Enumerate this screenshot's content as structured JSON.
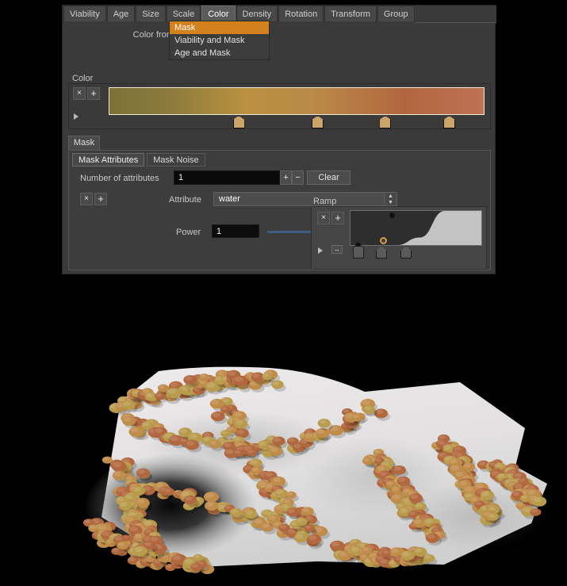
{
  "panel": {
    "tabs": [
      {
        "label": "Viability",
        "active": false
      },
      {
        "label": "Age",
        "active": false
      },
      {
        "label": "Size",
        "active": false
      },
      {
        "label": "Scale",
        "active": false
      },
      {
        "label": "Color",
        "active": true
      },
      {
        "label": "Density",
        "active": false
      },
      {
        "label": "Rotation",
        "active": false
      },
      {
        "label": "Transform",
        "active": false
      },
      {
        "label": "Group",
        "active": false
      }
    ],
    "color_from": {
      "label": "Color from",
      "value": "Mask",
      "open": true,
      "options": [
        "Mask",
        "Viability and Mask",
        "Age and Mask"
      ],
      "selected_index": 0
    },
    "color_section": {
      "label": "Color",
      "remove_label": "×",
      "add_label": "+",
      "gradient_stops": [
        {
          "position": 0.0,
          "color": "#7d7236"
        },
        {
          "position": 0.155,
          "color": "#8a7a3c"
        },
        {
          "position": 0.36,
          "color": "#b9913f"
        },
        {
          "position": 0.545,
          "color": "#b98a48"
        },
        {
          "position": 0.79,
          "color": "#b2663f"
        },
        {
          "position": 1.0,
          "color": "#bf7254"
        }
      ],
      "stop_markers": [
        0.345,
        0.555,
        0.735,
        0.905
      ]
    },
    "mask_group": {
      "tab_label": "Mask",
      "subtabs": [
        {
          "label": "Mask Attributes",
          "active": true
        },
        {
          "label": "Mask Noise",
          "active": false
        }
      ],
      "number_of_attributes": {
        "label": "Number of attributes",
        "value": "1",
        "increment": "+",
        "decrement": "−"
      },
      "clear_label": "Clear",
      "attribute_row": {
        "remove_label": "×",
        "add_label": "+",
        "label": "Attribute",
        "value": "water"
      },
      "power": {
        "label": "Power",
        "value": "1",
        "slider_position": 1.0
      },
      "ramp": {
        "label": "Ramp",
        "remove_label": "×",
        "add_label": "+",
        "fit_label": "↔",
        "curve_points": [
          {
            "x": 0.0,
            "y": 0.0
          },
          {
            "x": 0.355,
            "y": 0.0
          },
          {
            "x": 0.53,
            "y": 0.22
          },
          {
            "x": 0.72,
            "y": 1.0
          },
          {
            "x": 1.0,
            "y": 1.0
          }
        ],
        "handles": [
          {
            "position": 0.355,
            "type": "square",
            "selected": false
          },
          {
            "position": 0.53,
            "type": "house",
            "selected": true
          },
          {
            "position": 0.72,
            "type": "house",
            "selected": false
          }
        ]
      }
    }
  },
  "viewport": {
    "name": "3d-render-viewport",
    "background": "#000000",
    "description": "Terrain surface with scattered scatter-points colored by mask ramp"
  },
  "colors": {
    "accent_orange": "#d39a28",
    "panel_bg": "#3a3a3a",
    "field_bg": "#0a0a0a",
    "slider_blue": "#3f5d82"
  }
}
